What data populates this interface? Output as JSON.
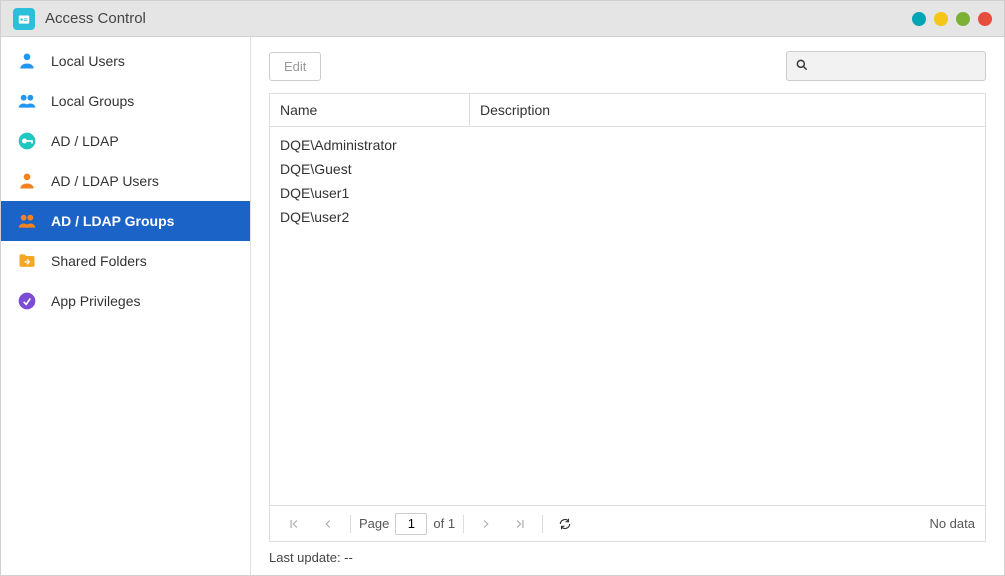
{
  "window": {
    "title": "Access Control"
  },
  "sidebar": {
    "items": [
      {
        "label": "Local Users"
      },
      {
        "label": "Local Groups"
      },
      {
        "label": "AD / LDAP"
      },
      {
        "label": "AD / LDAP Users"
      },
      {
        "label": "AD / LDAP Groups"
      },
      {
        "label": "Shared Folders"
      },
      {
        "label": "App Privileges"
      }
    ]
  },
  "toolbar": {
    "edit": "Edit"
  },
  "search": {
    "placeholder": ""
  },
  "table": {
    "columns": {
      "name": "Name",
      "description": "Description"
    },
    "rows": [
      {
        "name": "DQE\\Administrator",
        "description": ""
      },
      {
        "name": "DQE\\Guest",
        "description": ""
      },
      {
        "name": "DQE\\user1",
        "description": ""
      },
      {
        "name": "DQE\\user2",
        "description": ""
      }
    ]
  },
  "pager": {
    "page_label": "Page",
    "current": "1",
    "of_label": "of 1",
    "status": "No data"
  },
  "footer": {
    "last_update": "Last update: --"
  }
}
